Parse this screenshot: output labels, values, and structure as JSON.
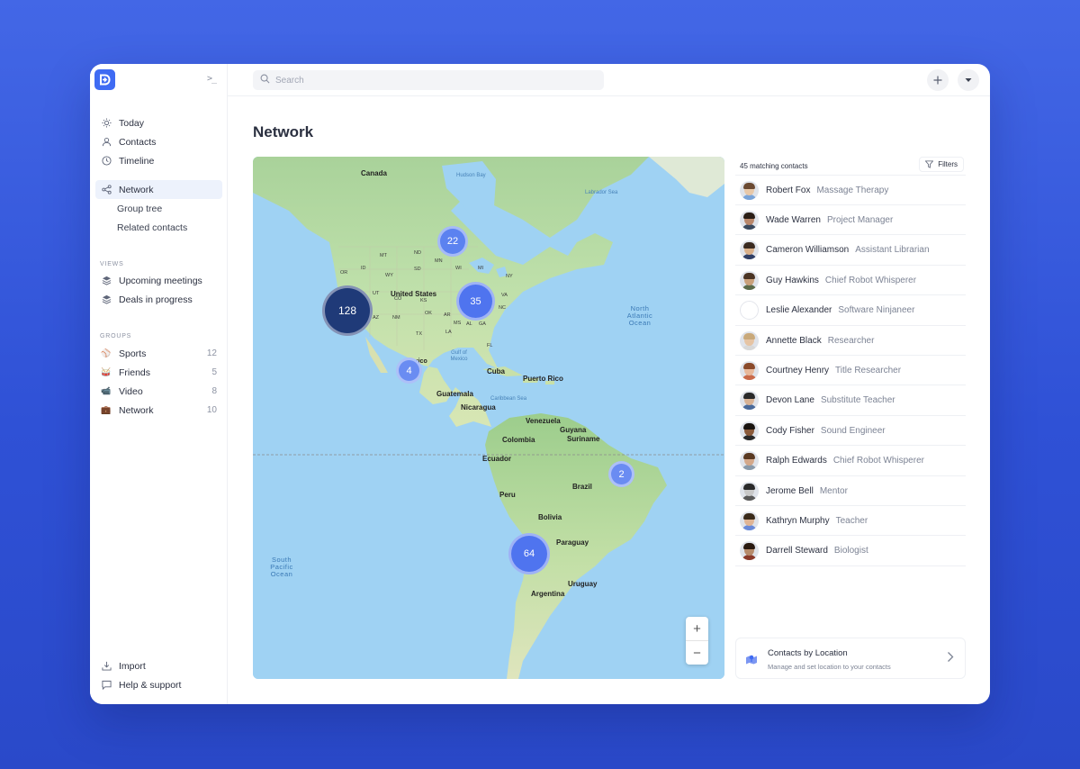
{
  "search": {
    "placeholder": "Search"
  },
  "sidebar": {
    "collapse_label": ">_",
    "nav": [
      {
        "label": "Today",
        "icon": "sun-icon"
      },
      {
        "label": "Contacts",
        "icon": "user-icon"
      },
      {
        "label": "Timeline",
        "icon": "clock-icon"
      }
    ],
    "network": {
      "label": "Network",
      "icon": "share-icon",
      "children": [
        "Group tree",
        "Related contacts"
      ]
    },
    "views_label": "VIEWS",
    "views": [
      {
        "label": "Upcoming meetings",
        "icon": "layers-icon"
      },
      {
        "label": "Deals in progress",
        "icon": "layers-icon"
      }
    ],
    "groups_label": "GROUPS",
    "groups": [
      {
        "label": "Sports",
        "count": "12",
        "icon": "⚾"
      },
      {
        "label": "Friends",
        "count": "5",
        "icon": "🥁"
      },
      {
        "label": "Video",
        "count": "8",
        "icon": "📹"
      },
      {
        "label": "Network",
        "count": "10",
        "icon": "💼"
      }
    ],
    "footer": [
      {
        "label": "Import",
        "icon": "download-icon"
      },
      {
        "label": "Help & support",
        "icon": "chat-icon"
      }
    ]
  },
  "main": {
    "title": "Network"
  },
  "map": {
    "clusters": [
      "22",
      "128",
      "35",
      "4",
      "2",
      "64"
    ],
    "labels": {
      "canada": "Canada",
      "hudson_bay": "Hudson Bay",
      "labrador_sea": "Labrador Sea",
      "united_states": "United States",
      "north_atlantic": "North Atlantic Ocean",
      "gulf_mexico": "Gulf of Mexico",
      "mexico": "Mexico",
      "cuba": "Cuba",
      "puerto_rico": "Puerto Rico",
      "guatemala": "Guatemala",
      "caribbean": "Caribbean Sea",
      "nicaragua": "Nicaragua",
      "venezuela": "Venezuela",
      "guyana": "Guyana",
      "suriname": "Suriname",
      "colombia": "Colombia",
      "ecuador": "Ecuador",
      "peru": "Peru",
      "brazil": "Brazil",
      "bolivia": "Bolivia",
      "paraguay": "Paraguay",
      "south_pacific": "South Pacific Ocean",
      "uruguay": "Uruguay",
      "argentina": "Argentina",
      "mt": "MT",
      "nd": "ND",
      "mn": "MN",
      "wi": "WI",
      "mi": "MI",
      "ny": "NY",
      "or": "OR",
      "id": "ID",
      "wy": "WY",
      "sd": "SD",
      "ut": "UT",
      "co": "CO",
      "ks": "KS",
      "ok": "OK",
      "tx": "TX",
      "az": "AZ",
      "nm": "NM",
      "ar": "AR",
      "ms": "MS",
      "al": "AL",
      "ga": "GA",
      "nc": "NC",
      "va": "VA",
      "fl": "FL",
      "la": "LA"
    },
    "zoom_in": "+",
    "zoom_out": "−"
  },
  "contacts": {
    "count_text": "45 matching contacts",
    "filters_label": "Filters",
    "items": [
      {
        "name": "Robert Fox",
        "role": "Massage Therapy"
      },
      {
        "name": "Wade Warren",
        "role": "Project Manager"
      },
      {
        "name": "Cameron Williamson",
        "role": "Assistant Librarian"
      },
      {
        "name": "Guy Hawkins",
        "role": "Chief Robot Whisperer"
      },
      {
        "name": "Leslie Alexander",
        "role": "Software Ninjaneer"
      },
      {
        "name": "Annette Black",
        "role": "Researcher"
      },
      {
        "name": "Courtney Henry",
        "role": "Title Researcher"
      },
      {
        "name": "Devon Lane",
        "role": "Substitute Teacher"
      },
      {
        "name": "Cody Fisher",
        "role": "Sound Engineer"
      },
      {
        "name": "Ralph Edwards",
        "role": "Chief Robot Whisperer"
      },
      {
        "name": "Jerome Bell",
        "role": "Mentor"
      },
      {
        "name": "Kathryn Murphy",
        "role": "Teacher"
      },
      {
        "name": "Darrell Steward",
        "role": "Biologist"
      }
    ],
    "location_card": {
      "title": "Contacts by Location",
      "subtitle": "Manage and set location to your contacts"
    }
  },
  "colors": {
    "brand": "#3f6bf3",
    "cluster_light": "#5b82f0",
    "cluster_dark": "#1f3a78",
    "ocean": "#9fd2f3",
    "land": "#b9dca6"
  }
}
